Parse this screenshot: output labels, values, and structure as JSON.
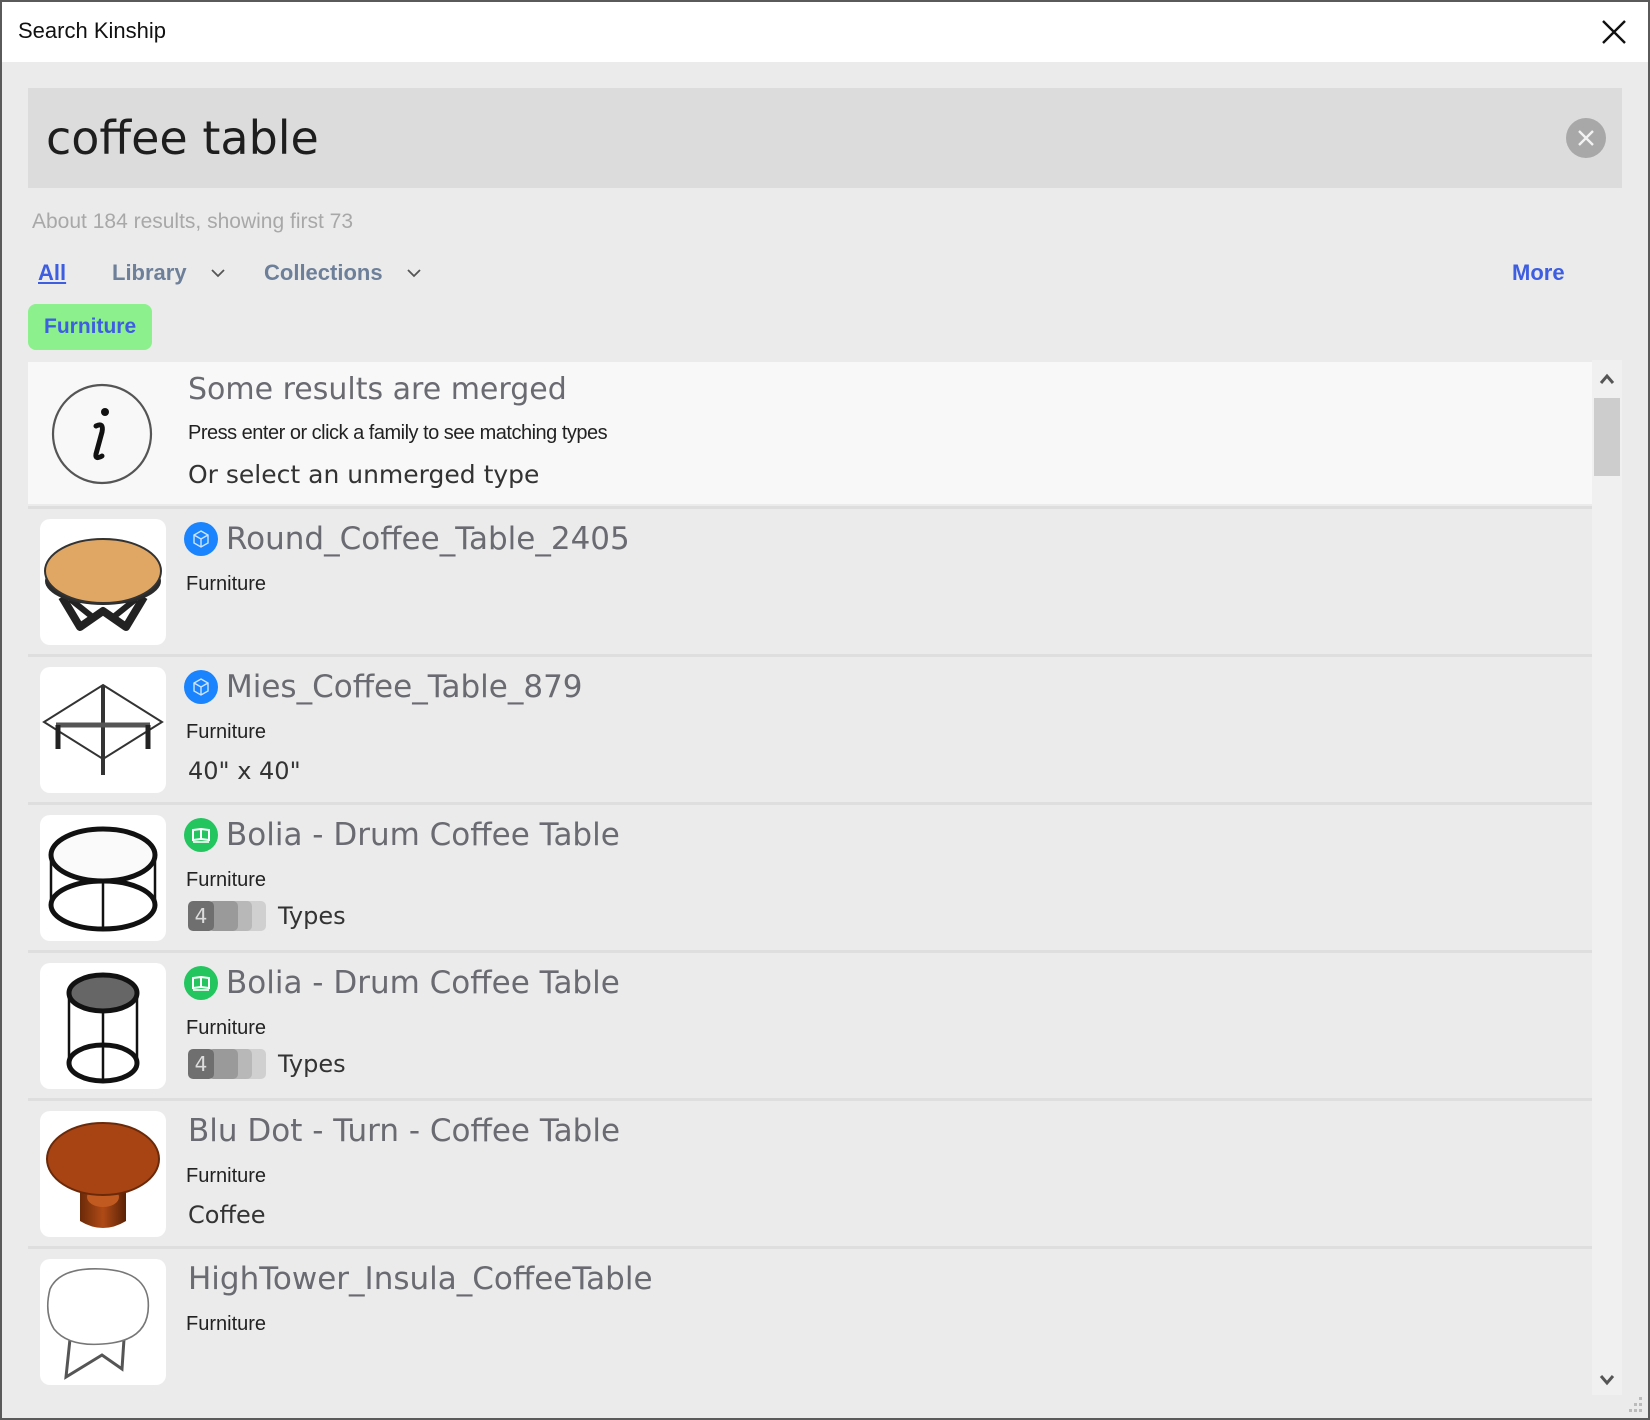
{
  "window": {
    "title": "Search Kinship",
    "close_icon": "close-icon"
  },
  "search": {
    "value": "coffee table",
    "placeholder": "",
    "clear_icon": "clear-circle-icon"
  },
  "results_info": "About 184 results, showing first 73",
  "filters": {
    "all": "All",
    "library": "Library",
    "collections": "Collections",
    "more": "More"
  },
  "active_chip": "Furniture",
  "colors": {
    "accent_blue": "#3d5ee0",
    "chip_green": "#8cf08c",
    "project_badge": "#1a84ff",
    "library_badge": "#22c55e"
  },
  "banner": {
    "icon": "info-icon",
    "title": "Some results are merged",
    "subtitle": "Press enter or click a family to see matching types",
    "subtitle2": "Or select an unmerged type"
  },
  "results": [
    {
      "title": "Round_Coffee_Table_2405",
      "category": "Furniture",
      "extra": "",
      "badge": "cube-icon",
      "thumb": "round-table"
    },
    {
      "title": "Mies_Coffee_Table_879",
      "category": "Furniture",
      "extra": "40\" x 40\"",
      "badge": "cube-icon",
      "thumb": "mies-table"
    },
    {
      "title": "Bolia - Drum Coffee Table",
      "category": "Furniture",
      "types_count": "4",
      "types_label": "Types",
      "badge": "book-icon",
      "thumb": "drum-white"
    },
    {
      "title": "Bolia - Drum Coffee Table",
      "category": "Furniture",
      "types_count": "4",
      "types_label": "Types",
      "badge": "book-icon",
      "thumb": "drum-dark"
    },
    {
      "title": "Blu Dot - Turn - Coffee Table",
      "category": "Furniture",
      "extra": "Coffee",
      "badge": "",
      "thumb": "turn-table"
    },
    {
      "title": "HighTower_Insula_CoffeeTable",
      "category": "Furniture",
      "extra": "",
      "badge": "",
      "thumb": "insula-table"
    }
  ]
}
